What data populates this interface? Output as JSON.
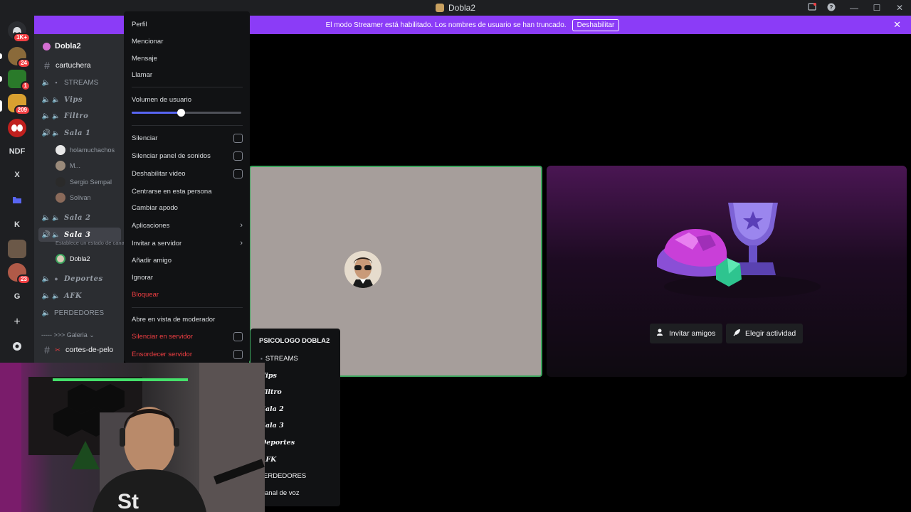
{
  "titlebar": {
    "title": "Dobla2",
    "app_icon": "discord-server-icon",
    "controls": [
      "inbox-icon",
      "help-icon",
      "minimize-icon",
      "maximize-icon",
      "close-icon"
    ]
  },
  "banner": {
    "message": "El modo Streamer está habilitado. Los nombres de usuario se han truncado.",
    "disable_label": "Deshabilitar",
    "bg_color": "#8b3cf7"
  },
  "servers": [
    {
      "label": "",
      "badge": "1K+"
    },
    {
      "label": "",
      "badge": "24"
    },
    {
      "label": "",
      "badge": "1"
    },
    {
      "label": "",
      "badge": "209"
    },
    {
      "label": "",
      "badge": ""
    },
    {
      "label": "NDF",
      "badge": ""
    },
    {
      "label": "X",
      "badge": ""
    },
    {
      "label": "",
      "badge": ""
    },
    {
      "label": "K",
      "badge": ""
    },
    {
      "label": "",
      "badge": ""
    },
    {
      "label": "",
      "badge": "23"
    },
    {
      "label": "G",
      "badge": ""
    },
    {
      "label": "+",
      "badge": ""
    },
    {
      "label": "",
      "badge": ""
    }
  ],
  "guild": {
    "name": "Dobla2"
  },
  "channels": {
    "cartuchera": "cartuchera",
    "streams": "STREAMS",
    "vips": "Vips",
    "filtro": "Filtro",
    "sala1": "Sala 1",
    "sala1_users": [
      "holamuchachos",
      "M...",
      "Sergio Sempal",
      "Solivan"
    ],
    "sala2": "Sala 2",
    "sala3": "Sala 3",
    "sala3_status": "Establece un estado de canal",
    "sala3_user": "Dobla2",
    "deportes": "Deportes",
    "afk": "AFK",
    "perdedores": "PERDEDORES",
    "galeria": "----- >>> Galeria",
    "cortes": "cortes-de-pelo"
  },
  "context_menu": {
    "perfil": "Perfil",
    "mencionar": "Mencionar",
    "mensaje": "Mensaje",
    "llamar": "Llamar",
    "volumen_label": "Volumen de usuario",
    "volumen_value": 0.45,
    "silenciar": "Silenciar",
    "silenciar_sonidos": "Silenciar panel de sonidos",
    "deshabilitar_video": "Deshabilitar video",
    "centrarse": "Centrarse en esta persona",
    "cambiar_apodo": "Cambiar apodo",
    "aplicaciones": "Aplicaciones",
    "invitar": "Invitar a servidor",
    "anadir_amigo": "Añadir amigo",
    "ignorar": "Ignorar",
    "bloquear": "Bloquear",
    "moderador": "Abre en vista de moderador",
    "silenciar_servidor": "Silenciar en servidor",
    "ensordecer_servidor": "Ensordecer servidor",
    "danger_color": "#f23f43",
    "accent_color": "#5865f2"
  },
  "activity": {
    "invite_label": "Invitar amigos",
    "choose_label": "Elegir actividad"
  },
  "channel_popup": {
    "title": "PSICOLOGO DOBLA2",
    "items": [
      "STREAMS",
      "Vips",
      "Filtro",
      "Sala 2",
      "Sala 3",
      "Deportes",
      "AFK",
      "ERDEDORES",
      "anal de voz"
    ]
  }
}
